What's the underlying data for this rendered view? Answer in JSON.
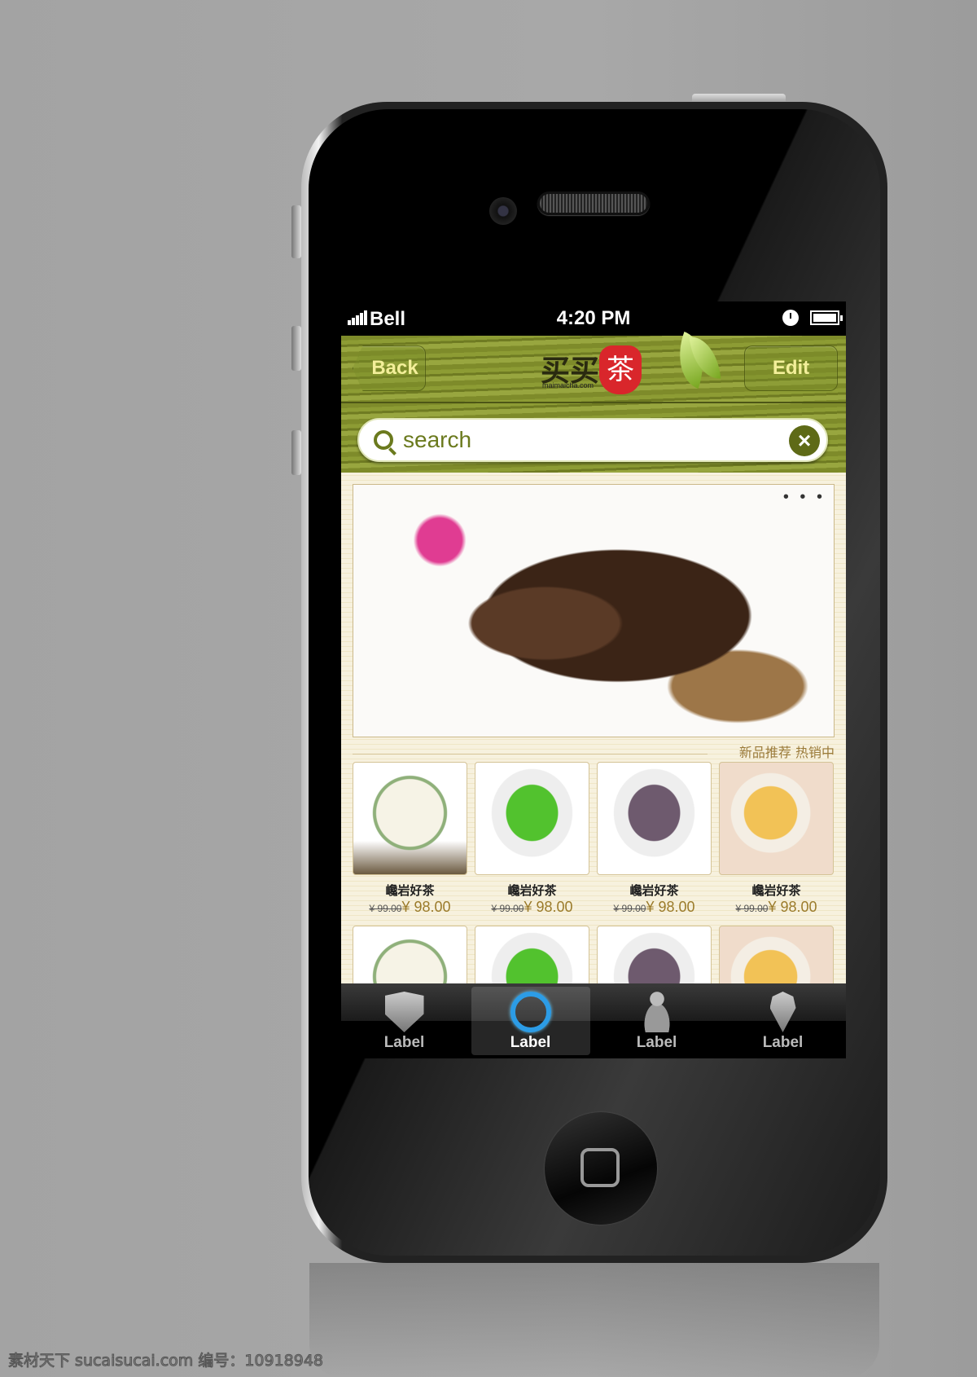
{
  "status_bar": {
    "carrier": "Bell",
    "time": "4:20 PM",
    "icons": [
      "signal-icon",
      "clock-icon",
      "battery-icon"
    ]
  },
  "nav": {
    "back_label": "Back",
    "edit_label": "Edit",
    "logo_text": "买买",
    "logo_mark": "茶",
    "logo_domain": "maimaicha.com"
  },
  "search": {
    "placeholder": "search",
    "clear_icon": "close-icon"
  },
  "banner": {
    "pager": "• • •"
  },
  "section_title": "新品推荐 热销中",
  "products": [
    {
      "name": "巉岩好茶",
      "old_price": "¥ 99.00",
      "price": "¥ 98.00"
    },
    {
      "name": "巉岩好茶",
      "old_price": "¥ 99.00",
      "price": "¥ 98.00"
    },
    {
      "name": "巉岩好茶",
      "old_price": "¥ 99.00",
      "price": "¥ 98.00"
    },
    {
      "name": "巉岩好茶",
      "old_price": "¥ 99.00",
      "price": "¥ 98.00"
    }
  ],
  "tabs": [
    {
      "label": "Label",
      "icon": "shield-icon",
      "active": false
    },
    {
      "label": "Label",
      "icon": "target-icon",
      "active": true
    },
    {
      "label": "Label",
      "icon": "joystick-icon",
      "active": false
    },
    {
      "label": "Label",
      "icon": "map-pin-icon",
      "active": false
    }
  ],
  "colors": {
    "accent": "#6b7a1e",
    "price": "#9b7b2a",
    "tab_active": "#2c9ce6",
    "logo_red": "#d9262b"
  },
  "watermark": "素材天下 sucaisucai.com  编号：10918948"
}
